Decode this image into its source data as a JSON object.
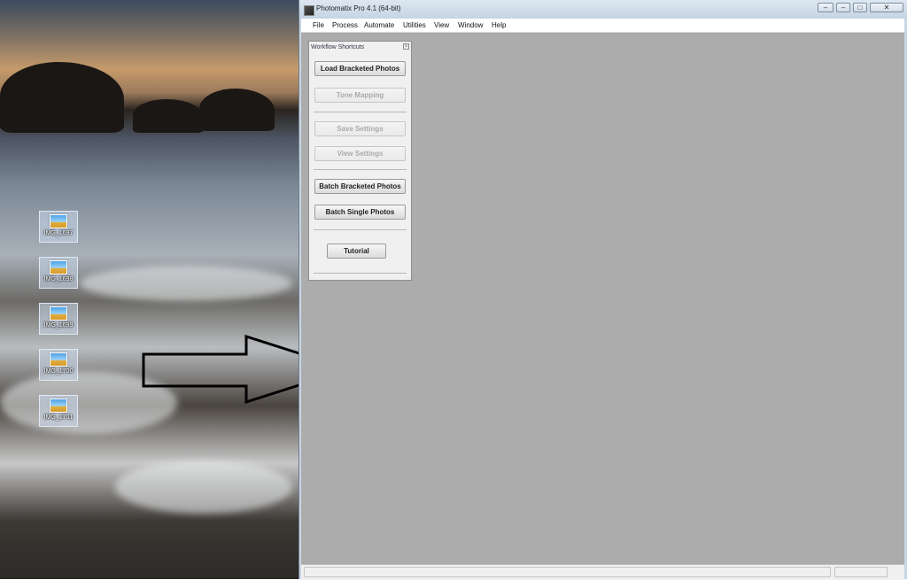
{
  "desktop": {
    "icons": [
      {
        "label": "IMG_1697",
        "icon": "image-file-icon"
      },
      {
        "label": "IMG_1698",
        "icon": "image-file-icon"
      },
      {
        "label": "IMG_1699",
        "icon": "image-file-icon"
      },
      {
        "label": "IMG_1700",
        "icon": "image-file-icon"
      },
      {
        "label": "IMG_1701",
        "icon": "image-file-icon"
      }
    ]
  },
  "window": {
    "title": "Photomatix Pro 4.1 (64-bit)",
    "controls": {
      "minimize": "–",
      "maximize": "□",
      "close": "✕"
    }
  },
  "menu": {
    "items": [
      "File",
      "Process",
      "Automate",
      "Utilities",
      "View",
      "Window",
      "Help"
    ]
  },
  "workflow_panel": {
    "title": "Workflow Shortcuts",
    "close_glyph": "×",
    "buttons": {
      "load_bracketed": "Load Bracketed Photos",
      "tone_mapping": "Tone Mapping",
      "save_settings": "Save Settings",
      "view_settings": "View Settings",
      "batch_bracketed": "Batch Bracketed Photos",
      "batch_single": "Batch Single Photos",
      "tutorial": "Tutorial"
    },
    "disabled": [
      "tone_mapping",
      "save_settings",
      "view_settings"
    ]
  },
  "colors": {
    "client_bg": "#acacac",
    "panel_bg": "#f0f0f0",
    "title_bar": "#c5d4e4"
  }
}
